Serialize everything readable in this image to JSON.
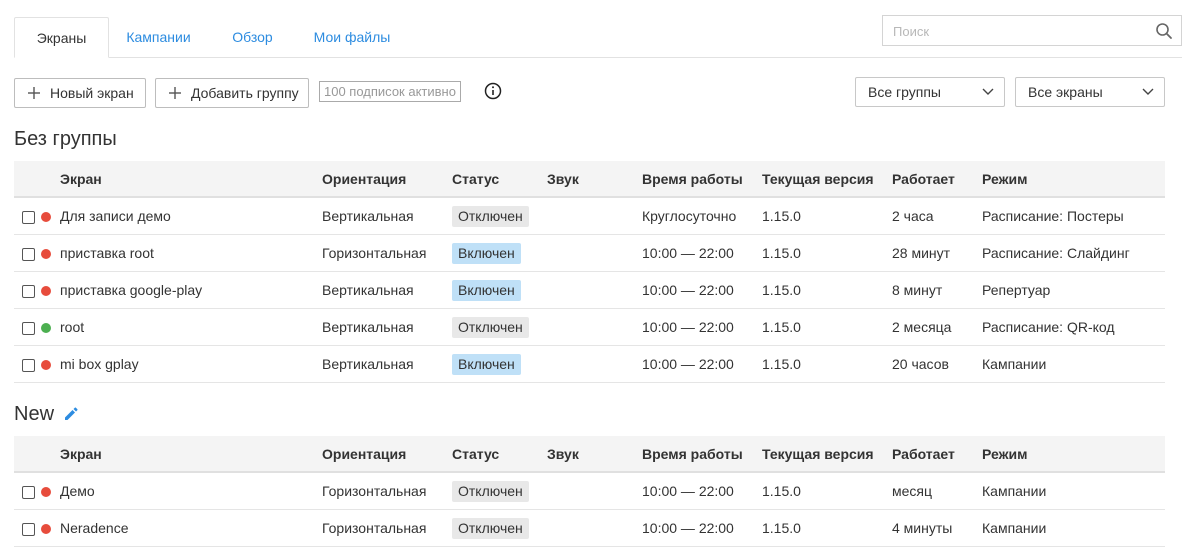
{
  "tabs": [
    {
      "label": "Экраны",
      "active": true
    },
    {
      "label": "Кампании",
      "active": false
    },
    {
      "label": "Обзор",
      "active": false
    },
    {
      "label": "Мои файлы",
      "active": false
    }
  ],
  "search": {
    "placeholder": "Поиск",
    "icon": "search-icon"
  },
  "toolbar": {
    "new_screen_label": "Новый экран",
    "add_group_label": "Добавить группу",
    "subscriptions_text": "100 подписок активно",
    "groups_filter": "Все группы",
    "screens_filter": "Все экраны"
  },
  "columns": [
    "Экран",
    "Ориентация",
    "Статус",
    "Звук",
    "Время работы",
    "Текущая версия",
    "Работает",
    "Режим"
  ],
  "colors": {
    "dot_red": "#e74c3c",
    "dot_green": "#4caf50",
    "badge_on": "#bfe0f7",
    "badge_off": "#e8e8e8",
    "link": "#2d8ce0"
  },
  "groups": [
    {
      "title": "Без группы",
      "editable": false,
      "rows": [
        {
          "name": "Для записи демо",
          "dot": "red",
          "orientation": "Вертикальная",
          "status": "Отключен",
          "status_on": false,
          "sound": "",
          "hours": "Круглосуточно",
          "version": "1.15.0",
          "uptime": "2 часа",
          "mode": "Расписание: Постеры"
        },
        {
          "name": "приставка root",
          "dot": "red",
          "orientation": "Горизонтальная",
          "status": "Включен",
          "status_on": true,
          "sound": "",
          "hours": "10:00 — 22:00",
          "version": "1.15.0",
          "uptime": "28 минут",
          "mode": "Расписание: Слайдинг"
        },
        {
          "name": "приставка google-play",
          "dot": "red",
          "orientation": "Вертикальная",
          "status": "Включен",
          "status_on": true,
          "sound": "",
          "hours": "10:00 — 22:00",
          "version": "1.15.0",
          "uptime": "8 минут",
          "mode": "Репертуар"
        },
        {
          "name": "root",
          "dot": "green",
          "orientation": "Вертикальная",
          "status": "Отключен",
          "status_on": false,
          "sound": "",
          "hours": "10:00 — 22:00",
          "version": "1.15.0",
          "uptime": "2 месяца",
          "mode": "Расписание: QR-код"
        },
        {
          "name": "mi box gplay",
          "dot": "red",
          "orientation": "Вертикальная",
          "status": "Включен",
          "status_on": true,
          "sound": "",
          "hours": "10:00 — 22:00",
          "version": "1.15.0",
          "uptime": "20 часов",
          "mode": "Кампании"
        }
      ]
    },
    {
      "title": "New",
      "editable": true,
      "rows": [
        {
          "name": "Демо",
          "dot": "red",
          "orientation": "Горизонтальная",
          "status": "Отключен",
          "status_on": false,
          "sound": "",
          "hours": "10:00 — 22:00",
          "version": "1.15.0",
          "uptime": "месяц",
          "mode": "Кампании"
        },
        {
          "name": "Neradence",
          "dot": "red",
          "orientation": "Горизонтальная",
          "status": "Отключен",
          "status_on": false,
          "sound": "",
          "hours": "10:00 — 22:00",
          "version": "1.15.0",
          "uptime": "4 минуты",
          "mode": "Кампании"
        }
      ]
    }
  ]
}
